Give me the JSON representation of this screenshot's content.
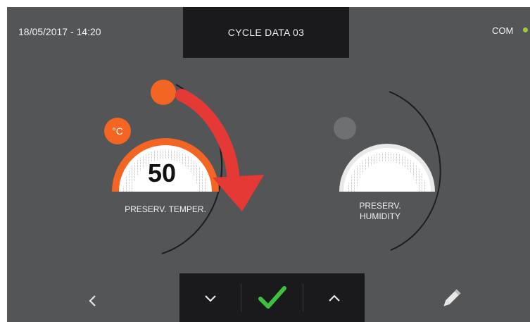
{
  "header": {
    "datetime": "18/05/2017 - 14:20",
    "title": "CYCLE DATA 03",
    "com_label": "COM"
  },
  "dials": {
    "temperature": {
      "label": "PRESERV. TEMPER.",
      "value": "50",
      "unit": "°C"
    },
    "humidity": {
      "label": "PRESERV.\nHUMIDITY"
    }
  },
  "footer": {
    "back_icon": "chevron-left-icon",
    "decrease_icon": "chevron-down-icon",
    "confirm_icon": "checkmark-icon",
    "increase_icon": "chevron-up-icon",
    "edit_icon": "pencil-icon"
  },
  "colors": {
    "background": "#545557",
    "panel": "#1a1a1c",
    "accent_orange": "#f26522",
    "arrow_red": "#e53935",
    "confirm_green": "#3fbf3f",
    "com_indicator": "#9fcb3a"
  }
}
